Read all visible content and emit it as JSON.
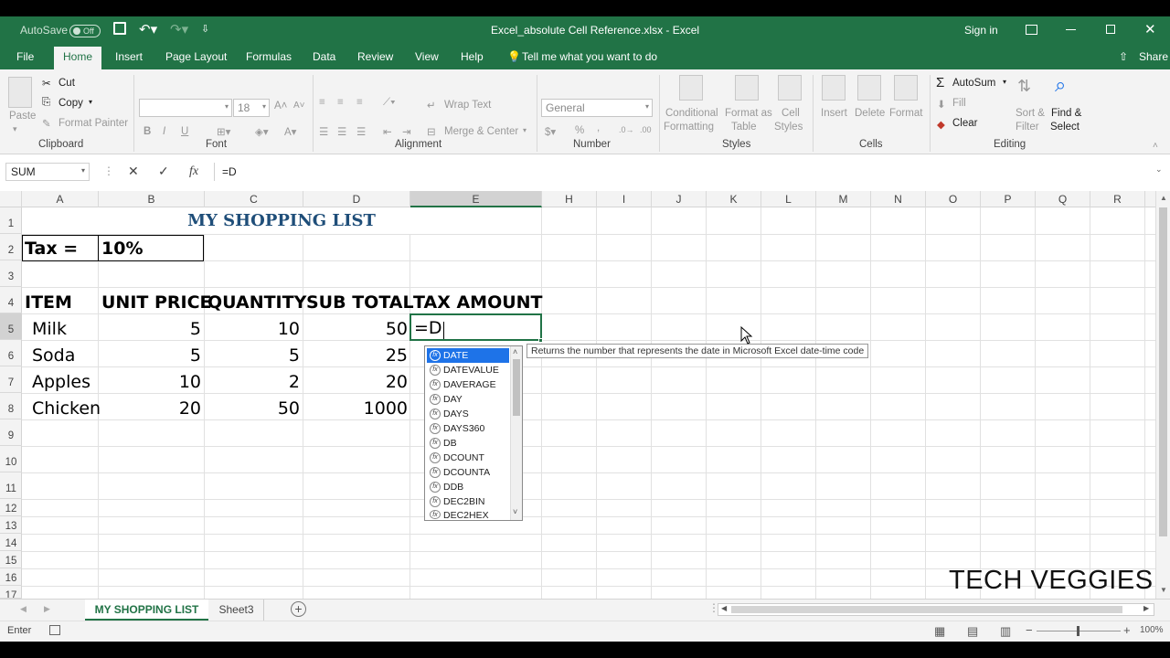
{
  "title_bar": {
    "autosave_label": "AutoSave",
    "autosave_state": "Off",
    "document_title": "Excel_absolute Cell Reference.xlsx  -  Excel",
    "sign_in": "Sign in"
  },
  "ribbon_tabs": [
    "File",
    "Home",
    "Insert",
    "Page Layout",
    "Formulas",
    "Data",
    "Review",
    "View",
    "Help"
  ],
  "tell_me": "Tell me what you want to do",
  "share": "Share",
  "ribbon": {
    "clipboard": {
      "paste": "Paste",
      "cut": "Cut",
      "copy": "Copy",
      "format_painter": "Format Painter",
      "label": "Clipboard"
    },
    "font": {
      "font_size": "18",
      "label": "Font",
      "bold": "B",
      "italic": "I",
      "underline": "U"
    },
    "alignment": {
      "wrap_text": "Wrap Text",
      "merge_center": "Merge & Center",
      "label": "Alignment"
    },
    "number": {
      "format": "General",
      "percent": "%",
      "comma": ",",
      "label": "Number"
    },
    "styles": {
      "conditional": "Conditional",
      "formatting": "Formatting",
      "format_as": "Format as",
      "table": "Table",
      "cell": "Cell",
      "cell_styles": "Styles",
      "label": "Styles"
    },
    "cells": {
      "insert": "Insert",
      "delete": "Delete",
      "format": "Format",
      "label": "Cells"
    },
    "editing": {
      "autosum": "AutoSum",
      "fill": "Fill",
      "clear": "Clear",
      "sort": "Sort &",
      "filter": "Filter",
      "find": "Find &",
      "select": "Select",
      "label": "Editing"
    }
  },
  "formula_bar": {
    "name_box": "SUM",
    "fx": "fx",
    "content": "=D"
  },
  "columns": [
    "A",
    "B",
    "C",
    "D",
    "E",
    "H",
    "I",
    "J",
    "K",
    "L",
    "M",
    "N",
    "O",
    "P",
    "Q",
    "R"
  ],
  "rows": [
    "1",
    "2",
    "3",
    "4",
    "5",
    "6",
    "7",
    "8",
    "9",
    "10",
    "11",
    "12",
    "13",
    "14",
    "15",
    "16",
    "17"
  ],
  "sheet": {
    "title": "MY SHOPPING LIST",
    "tax_label": "Tax =",
    "tax_value": "10%",
    "headers": [
      "ITEM",
      "UNIT PRICE",
      "QUANTITY",
      "SUB TOTAL",
      "TAX AMOUNT"
    ],
    "data": [
      {
        "item": "Milk",
        "price": "5",
        "qty": "10",
        "subtotal": "50"
      },
      {
        "item": "Soda",
        "price": "5",
        "qty": "5",
        "subtotal": "25"
      },
      {
        "item": "Apples",
        "price": "10",
        "qty": "2",
        "subtotal": "20"
      },
      {
        "item": "Chicken",
        "price": "20",
        "qty": "50",
        "subtotal": "1000"
      }
    ],
    "editing_cell": "=D"
  },
  "autocomplete": {
    "items": [
      "DATE",
      "DATEVALUE",
      "DAVERAGE",
      "DAY",
      "DAYS",
      "DAYS360",
      "DB",
      "DCOUNT",
      "DCOUNTA",
      "DDB",
      "DEC2BIN",
      "DEC2HEX"
    ],
    "selected": "DATE",
    "tooltip": "Returns the number that represents the date in Microsoft Excel date-time code"
  },
  "watermark": "TECH VEGGIES",
  "sheet_tabs": [
    "MY SHOPPING LIST",
    "Sheet3"
  ],
  "status": {
    "mode": "Enter",
    "zoom": "100%"
  },
  "colors": {
    "excel_green": "#217346",
    "selection_blue": "#1e73e8",
    "title_blue": "#1f4e79"
  }
}
